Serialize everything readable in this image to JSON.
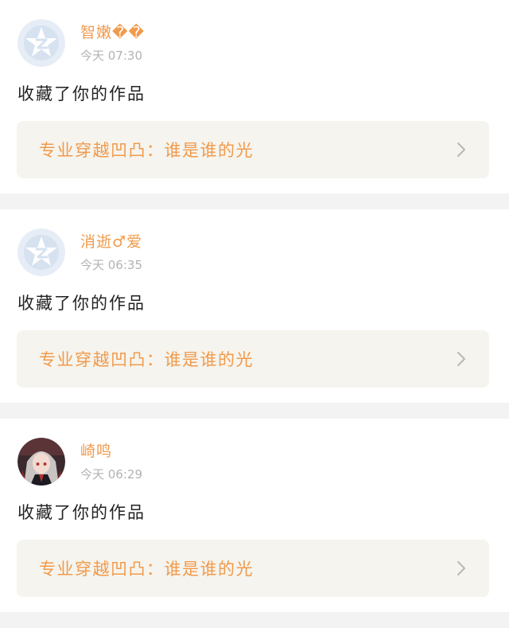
{
  "notifications": [
    {
      "username": "智嫩��",
      "time": "今天 07:30",
      "action": "收藏了你的作品",
      "work_title": "专业穿越凹凸：谁是谁的光",
      "avatar": "default-qq-avatar"
    },
    {
      "username": "消逝♂爱",
      "time": "今天 06:35",
      "action": "收藏了你的作品",
      "work_title": "专业穿越凹凸：谁是谁的光",
      "avatar": "default-qq-avatar"
    },
    {
      "username": "崎鸣",
      "time": "今天 06:29",
      "action": "收藏了你的作品",
      "work_title": "专业穿越凹凸：谁是谁的光",
      "avatar": "anime-character-avatar"
    }
  ],
  "icons": {
    "chevron": "chevron-right-icon"
  },
  "colors": {
    "accent": "#f19a4b",
    "card_bg": "#f5f4ee",
    "separator": "#f3f3f3",
    "time": "#b3b3b3"
  }
}
